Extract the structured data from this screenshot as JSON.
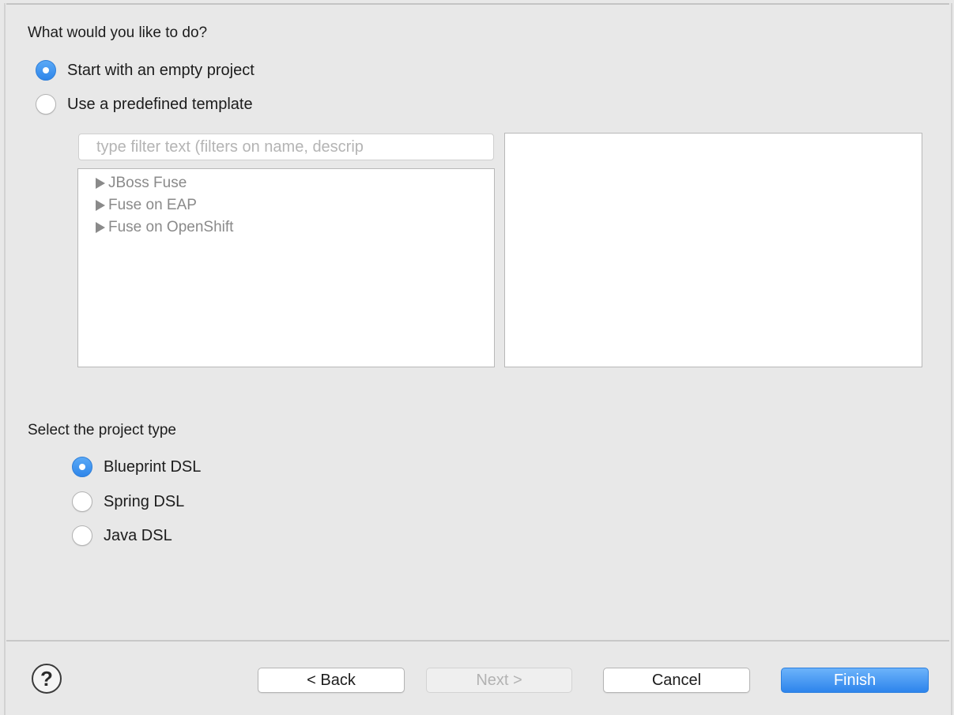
{
  "options": {
    "heading": "What would you like to do?",
    "empty_project_label": "Start with an empty project",
    "empty_project_selected": true,
    "template_label": "Use a predefined template",
    "template_selected": false
  },
  "template_filter": {
    "placeholder": "type filter text (filters on name, descrip",
    "value": ""
  },
  "template_tree": {
    "items": [
      {
        "label": "JBoss Fuse",
        "icon": "triangle-right-icon"
      },
      {
        "label": "Fuse on EAP",
        "icon": "triangle-right-icon"
      },
      {
        "label": "Fuse on OpenShift",
        "icon": "triangle-right-icon"
      }
    ]
  },
  "project_type": {
    "heading": "Select the project type",
    "options": [
      {
        "label": "Blueprint DSL",
        "selected": true
      },
      {
        "label": "Spring DSL",
        "selected": false
      },
      {
        "label": "Java DSL",
        "selected": false
      }
    ]
  },
  "footer": {
    "help_icon": "?",
    "back_label": "< Back",
    "next_label": "Next >",
    "cancel_label": "Cancel",
    "finish_label": "Finish"
  },
  "colors": {
    "accent": "#2f86ea",
    "background": "#e8e8e8",
    "disabled_text": "#b2b2b2"
  }
}
